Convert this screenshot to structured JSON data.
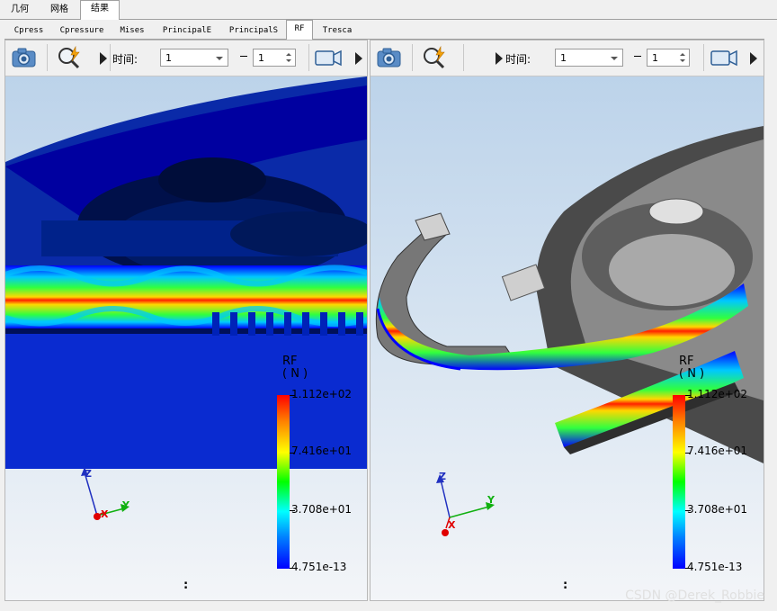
{
  "top_tabs": [
    {
      "label": "几何",
      "active": false
    },
    {
      "label": "网格",
      "active": false
    },
    {
      "label": "结果",
      "active": true
    }
  ],
  "result_tabs": [
    {
      "label": "Cpress",
      "active": false
    },
    {
      "label": "Cpressure",
      "active": false
    },
    {
      "label": "Mises",
      "active": false
    },
    {
      "label": "PrincipalE",
      "active": false
    },
    {
      "label": "PrincipalS",
      "active": false
    },
    {
      "label": "RF",
      "active": true
    },
    {
      "label": "Tresca",
      "active": false
    }
  ],
  "panes": [
    {
      "time_label": "时间:",
      "time_value": "1",
      "step_value": "1",
      "legend": {
        "title": "RF",
        "unit": "( N )",
        "max": "1.112e+02",
        "v2": "7.416e+01",
        "v3": "3.708e+01",
        "min": "4.751e-13"
      },
      "axes": {
        "z": "Z",
        "y": "Y",
        "x": "X"
      },
      "status": ":"
    },
    {
      "time_label": "时间:",
      "time_value": "1",
      "step_value": "1",
      "legend": {
        "title": "RF",
        "unit": "( N )",
        "max": "1.112e+02",
        "v2": "7.416e+01",
        "v3": "3.708e+01",
        "min": "4.751e-13"
      },
      "axes": {
        "z": "Z",
        "y": "Y",
        "x": "X"
      },
      "status": ":"
    }
  ],
  "icons": [
    "camera-icon",
    "zoom-fit-icon",
    "video-camera-icon",
    "arrow-right-icon"
  ],
  "colors": {
    "accent_red": "#ff0000",
    "accent_blue": "#0000ff",
    "model_gray": "#6d6d6d"
  },
  "watermark": "CSDN @Derek_Robbie"
}
